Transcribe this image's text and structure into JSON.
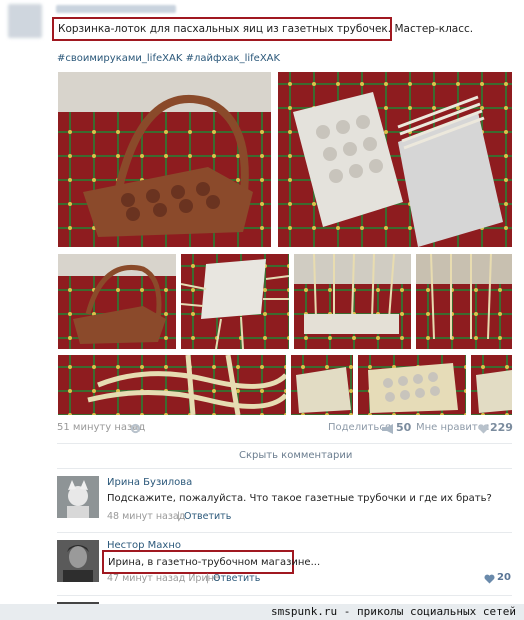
{
  "post": {
    "title": "Корзинка-лоток для пасхальных яиц из газетных трубочек. Мастер-класс.",
    "tags": "#своимируками_lifeXAK #лайфхак_lifeXAK",
    "time": "51 минуту назад",
    "share_label": "Поделиться",
    "share_count": "50",
    "like_label": "Мне нравится",
    "like_count": "229",
    "hide_comments": "Скрыть комментарии"
  },
  "comments": [
    {
      "author": "Ирина Бузилова",
      "text": "Подскажите, пожалуйста. Что такое газетные трубочки и где их брать?",
      "time": "48 минут назад",
      "reply": "Ответить"
    },
    {
      "author": "Нестор Махно",
      "text": "Ирина, в газетно-трубочном магазине...",
      "time": "47 минут назад Ирине",
      "reply": "Ответить",
      "likes": "20"
    }
  ],
  "watermark": "smspunk.ru - приколы социальных сетей",
  "icons": [
    "gear-icon",
    "megaphone-icon",
    "heart-icon"
  ],
  "colors": {
    "link": "#2b587a",
    "highlight": "#a01820",
    "tablecloth": "#8e1c1f"
  }
}
